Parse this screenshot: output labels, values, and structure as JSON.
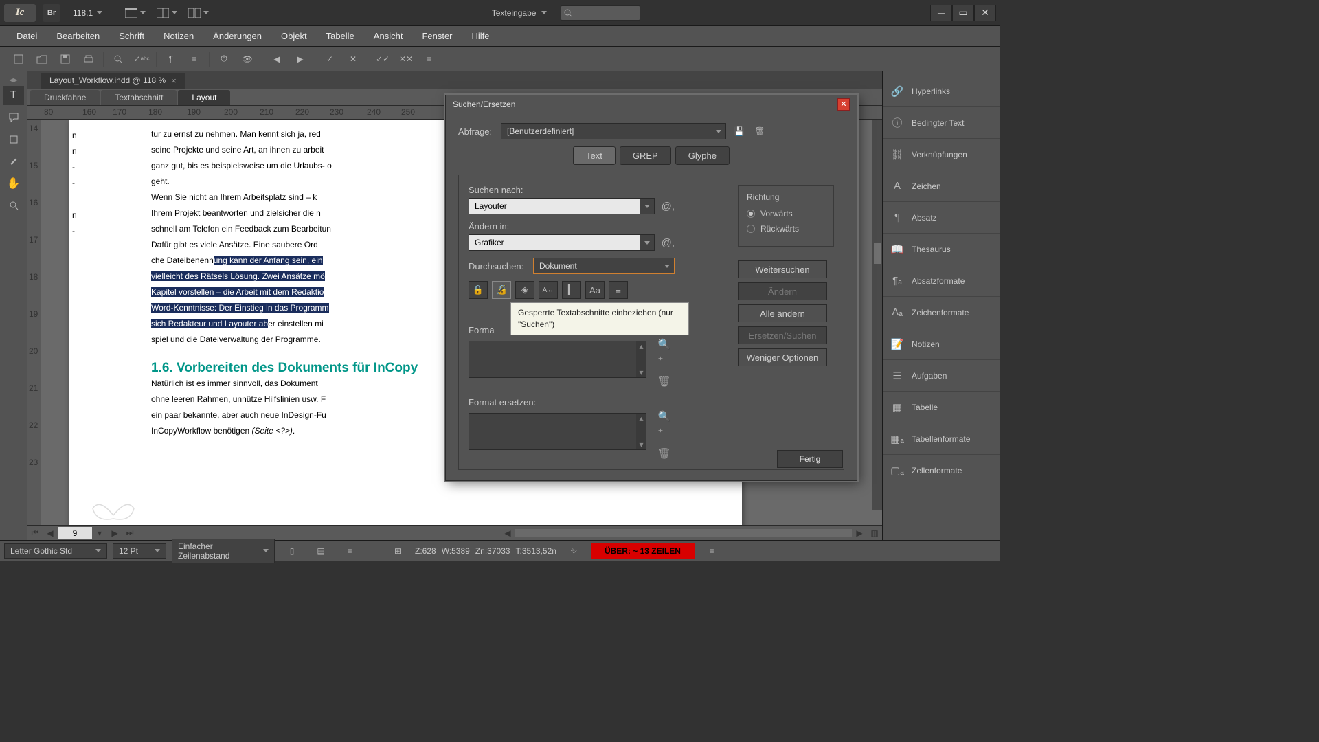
{
  "app": {
    "logo": "Ic",
    "bridge": "Br",
    "zoom": "118,1"
  },
  "workspace": {
    "label": "Texteingabe"
  },
  "menu": [
    "Datei",
    "Bearbeiten",
    "Schrift",
    "Notizen",
    "Änderungen",
    "Objekt",
    "Tabelle",
    "Ansicht",
    "Fenster",
    "Hilfe"
  ],
  "document": {
    "tab": "Layout_Workflow.indd @ 118 %",
    "close": "×"
  },
  "viewTabs": [
    "Druckfahne",
    "Textabschnitt",
    "Layout"
  ],
  "ruler_marks": [
    "80",
    "160",
    "170",
    "180",
    "190",
    "200",
    "210",
    "220",
    "230",
    "240",
    "250"
  ],
  "ruler_v": [
    "14",
    "15",
    "16",
    "17",
    "18",
    "19",
    "20",
    "21",
    "22",
    "23"
  ],
  "body": {
    "p1a": "tur zu ernst zu nehmen. Man kennt sich ja, red",
    "p1b": "seine Projekte und seine Art, an ihnen zu arbeit",
    "p1c": "ganz gut, bis es beispielsweise um die Urlaubs- o",
    "p1d": "geht.",
    "p2a": "     Wenn Sie nicht an Ihrem Arbeitsplatz sind – k",
    "p2b": "Ihrem Projekt beantworten und zielsicher die n",
    "p2c": "schnell am Telefon ein Feedback zum Bearbeitun",
    "p3a": "     Dafür gibt es viele Ansätze. Eine saubere Ord",
    "p3b_pre": "che Dateibenenn",
    "p3b_hi": "ung kann der Anfang sein, ein",
    "p3c_hi": "vielleicht des Rätsels Lösung. Zwei Ansätze mö",
    "p3d_hi": "Kapitel vorstellen – die Arbeit mit dem Redaktio",
    "p3e_hi": "Word-Kenntnisse: Der Einstieg in das Programm",
    "p3f_hi": "sich Redakteur und Layouter ab",
    "p3f_post": "er einstellen mi",
    "p3g": "spiel und die Dateiverwaltung der Programme.",
    "heading": "1.6.   Vorbereiten des Dokuments für InCopy",
    "p4a": "Natürlich ist es immer sinnvoll, das Dokument",
    "p4b": "ohne leeren Rahmen, unnütze Hilfslinien usw. F",
    "p4c": "ein paar bekannte, aber auch neue InDesign-Fu",
    "p4d_a": "InCopyWorkflow benötigen ",
    "p4d_i": "(Seite <?>)",
    "p4d_b": "."
  },
  "leftcol": [
    "n",
    "n",
    "-",
    "-",
    "n",
    "-"
  ],
  "dialog": {
    "title": "Suchen/Ersetzen",
    "query_label": "Abfrage:",
    "query_value": "[Benutzerdefiniert]",
    "tabs": [
      "Text",
      "GREP",
      "Glyphe"
    ],
    "search_label": "Suchen nach:",
    "search_value": "Layouter",
    "change_label": "Ändern in:",
    "change_value": "Grafiker",
    "scope_label": "Durchsuchen:",
    "scope_value": "Dokument",
    "tooltip": "Gesperrte Textabschnitte einbeziehen (nur \"Suchen\")",
    "findfmt_label": "Forma",
    "replfmt_label": "Format ersetzen:",
    "dir_label": "Richtung",
    "dir_fwd": "Vorwärts",
    "dir_back": "Rückwärts",
    "btn_next": "Weitersuchen",
    "btn_change": "Ändern",
    "btn_changeall": "Alle ändern",
    "btn_changefind": "Ersetzen/Suchen",
    "btn_fewer": "Weniger Optionen",
    "btn_done": "Fertig"
  },
  "panels": [
    "Hyperlinks",
    "Bedingter Text",
    "Verknüpfungen",
    "Zeichen",
    "Absatz",
    "Thesaurus",
    "Absatzformate",
    "Zeichenformate",
    "Notizen",
    "Aufgaben",
    "Tabelle",
    "Tabellenformate",
    "Zellenformate"
  ],
  "status": {
    "font": "Letter Gothic Std",
    "size": "12 Pt",
    "leading": "Einfacher Zeilenabstand",
    "z": "Z:628",
    "w": "W:5389",
    "zn": "Zn:37033",
    "t": "T:3513,52n",
    "overset": "ÜBER:  ~ 13 ZEILEN",
    "page": "9"
  }
}
